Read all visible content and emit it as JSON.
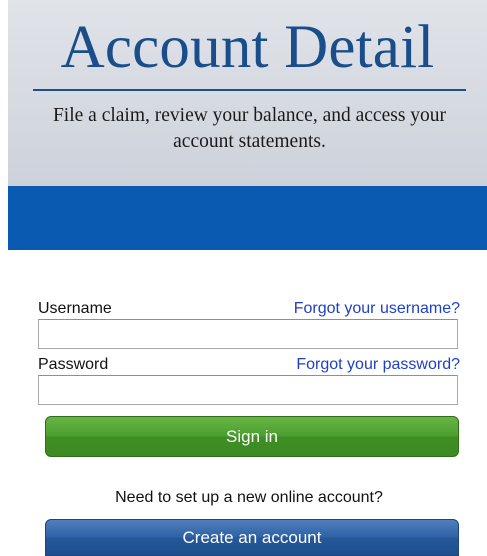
{
  "banner": {
    "title": "Account Detail",
    "subtitle": "File a claim, review your balance, and access your account statements."
  },
  "login": {
    "username_label": "Username",
    "forgot_username_link": "Forgot your username?",
    "username_value": "",
    "password_label": "Password",
    "forgot_password_link": "Forgot your password?",
    "password_value": "",
    "sign_in_button": "Sign in"
  },
  "signup": {
    "prompt": "Need to set up a new online account?",
    "create_account_button": "Create an account"
  },
  "colors": {
    "title_blue": "#1a4e8a",
    "banner_bar_blue": "#0b5ab2",
    "link_blue": "#1f3fc7",
    "sign_in_green": "#4c9f2f",
    "create_account_blue": "#2f63a6"
  }
}
